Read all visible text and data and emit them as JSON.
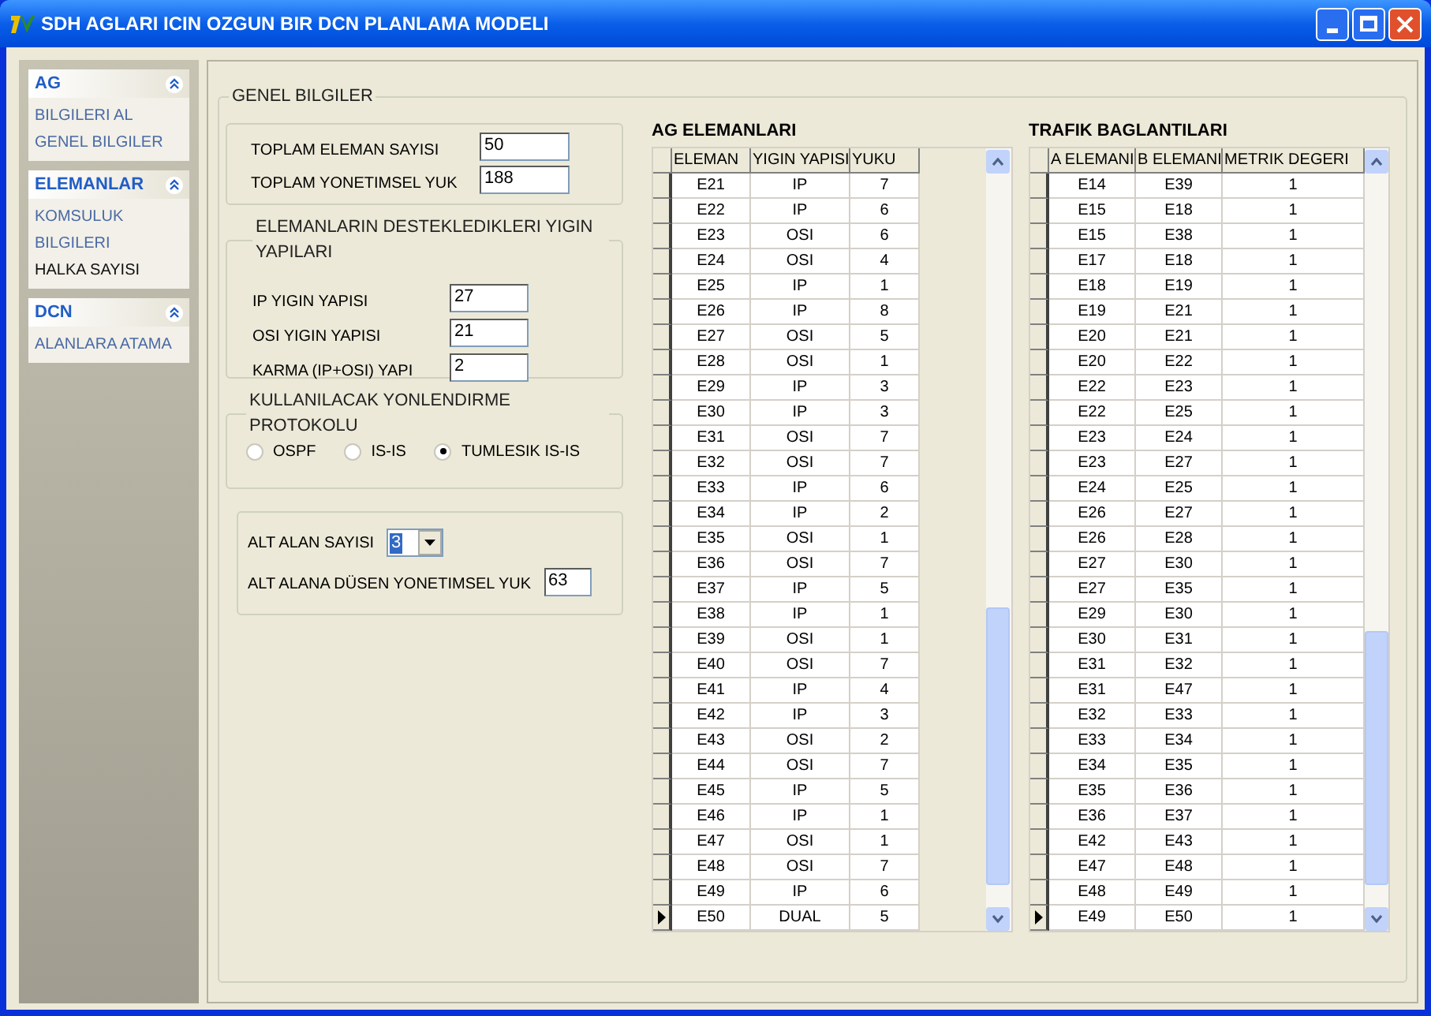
{
  "window": {
    "title": "SDH AGLARI ICIN OZGUN BIR DCN PLANLAMA MODELI"
  },
  "sidebar": [
    {
      "title": "AG",
      "items": [
        {
          "label": "BILGILERI AL",
          "selected": false
        },
        {
          "label": "GENEL BILGILER",
          "selected": false
        }
      ]
    },
    {
      "title": "ELEMANLAR",
      "items": [
        {
          "label": "KOMSULUK BILGILERI",
          "selected": false
        },
        {
          "label": "HALKA SAYISI",
          "selected": true
        }
      ]
    },
    {
      "title": "DCN",
      "items": [
        {
          "label": "ALANLARA ATAMA",
          "selected": false
        }
      ]
    }
  ],
  "main": {
    "title": "GENEL BILGILER",
    "totals": [
      {
        "label": "TOPLAM ELEMAN SAYISI",
        "value": "50"
      },
      {
        "label": "TOPLAM YONETIMSEL YUK",
        "value": "188"
      }
    ],
    "stacks": {
      "title": "ELEMANLARIN DESTEKLEDIKLERI YIGIN YAPILARI",
      "fields": [
        {
          "label": "IP YIGIN YAPISI",
          "value": "27"
        },
        {
          "label": "OSI YIGIN YAPISI",
          "value": "21"
        },
        {
          "label": "KARMA (IP+OSI) YAPI",
          "value": "2"
        }
      ]
    },
    "protocol": {
      "title": "KULLANILACAK YONLENDIRME PROTOKOLU",
      "options": [
        {
          "label": "OSPF",
          "selected": false
        },
        {
          "label": "IS-IS",
          "selected": false
        },
        {
          "label": "TUMLESIK IS-IS",
          "selected": true
        }
      ]
    },
    "subarea": {
      "count_label": "ALT ALAN SAYISI",
      "count_value": "3",
      "load_label": "ALT ALANA DÜSEN YONETIMSEL YUK",
      "load_value": "63"
    }
  },
  "tables": [
    {
      "title": "AG ELEMANLARI",
      "columns": [
        "ELEMAN",
        "YIGIN YAPISI",
        "YUKU"
      ],
      "rows": [
        {
          "cells": [
            "E21",
            "IP",
            "7"
          ],
          "selected": false
        },
        {
          "cells": [
            "E22",
            "IP",
            "6"
          ],
          "selected": false
        },
        {
          "cells": [
            "E23",
            "OSI",
            "6"
          ],
          "selected": false
        },
        {
          "cells": [
            "E24",
            "OSI",
            "4"
          ],
          "selected": false
        },
        {
          "cells": [
            "E25",
            "IP",
            "1"
          ],
          "selected": false
        },
        {
          "cells": [
            "E26",
            "IP",
            "8"
          ],
          "selected": false
        },
        {
          "cells": [
            "E27",
            "OSI",
            "5"
          ],
          "selected": false
        },
        {
          "cells": [
            "E28",
            "OSI",
            "1"
          ],
          "selected": false
        },
        {
          "cells": [
            "E29",
            "IP",
            "3"
          ],
          "selected": false
        },
        {
          "cells": [
            "E30",
            "IP",
            "3"
          ],
          "selected": false
        },
        {
          "cells": [
            "E31",
            "OSI",
            "7"
          ],
          "selected": false
        },
        {
          "cells": [
            "E32",
            "OSI",
            "7"
          ],
          "selected": false
        },
        {
          "cells": [
            "E33",
            "IP",
            "6"
          ],
          "selected": false
        },
        {
          "cells": [
            "E34",
            "IP",
            "2"
          ],
          "selected": false
        },
        {
          "cells": [
            "E35",
            "OSI",
            "1"
          ],
          "selected": false
        },
        {
          "cells": [
            "E36",
            "OSI",
            "7"
          ],
          "selected": false
        },
        {
          "cells": [
            "E37",
            "IP",
            "5"
          ],
          "selected": false
        },
        {
          "cells": [
            "E38",
            "IP",
            "1"
          ],
          "selected": false
        },
        {
          "cells": [
            "E39",
            "OSI",
            "1"
          ],
          "selected": false
        },
        {
          "cells": [
            "E40",
            "OSI",
            "7"
          ],
          "selected": false
        },
        {
          "cells": [
            "E41",
            "IP",
            "4"
          ],
          "selected": false
        },
        {
          "cells": [
            "E42",
            "IP",
            "3"
          ],
          "selected": false
        },
        {
          "cells": [
            "E43",
            "OSI",
            "2"
          ],
          "selected": false
        },
        {
          "cells": [
            "E44",
            "OSI",
            "7"
          ],
          "selected": false
        },
        {
          "cells": [
            "E45",
            "IP",
            "5"
          ],
          "selected": false
        },
        {
          "cells": [
            "E46",
            "IP",
            "1"
          ],
          "selected": false
        },
        {
          "cells": [
            "E47",
            "OSI",
            "1"
          ],
          "selected": false
        },
        {
          "cells": [
            "E48",
            "OSI",
            "7"
          ],
          "selected": false
        },
        {
          "cells": [
            "E49",
            "IP",
            "6"
          ],
          "selected": false
        },
        {
          "cells": [
            "E50",
            "DUAL",
            "5"
          ],
          "selected": true
        }
      ]
    },
    {
      "title": "TRAFIK BAGLANTILARI",
      "columns": [
        "A ELEMANI",
        "B ELEMANI",
        "METRIK DEGERI"
      ],
      "rows": [
        {
          "cells": [
            "E14",
            "E39",
            "1"
          ],
          "selected": false
        },
        {
          "cells": [
            "E15",
            "E18",
            "1"
          ],
          "selected": false
        },
        {
          "cells": [
            "E15",
            "E38",
            "1"
          ],
          "selected": false
        },
        {
          "cells": [
            "E17",
            "E18",
            "1"
          ],
          "selected": false
        },
        {
          "cells": [
            "E18",
            "E19",
            "1"
          ],
          "selected": false
        },
        {
          "cells": [
            "E19",
            "E21",
            "1"
          ],
          "selected": false
        },
        {
          "cells": [
            "E20",
            "E21",
            "1"
          ],
          "selected": false
        },
        {
          "cells": [
            "E20",
            "E22",
            "1"
          ],
          "selected": false
        },
        {
          "cells": [
            "E22",
            "E23",
            "1"
          ],
          "selected": false
        },
        {
          "cells": [
            "E22",
            "E25",
            "1"
          ],
          "selected": false
        },
        {
          "cells": [
            "E23",
            "E24",
            "1"
          ],
          "selected": false
        },
        {
          "cells": [
            "E23",
            "E27",
            "1"
          ],
          "selected": false
        },
        {
          "cells": [
            "E24",
            "E25",
            "1"
          ],
          "selected": false
        },
        {
          "cells": [
            "E26",
            "E27",
            "1"
          ],
          "selected": false
        },
        {
          "cells": [
            "E26",
            "E28",
            "1"
          ],
          "selected": false
        },
        {
          "cells": [
            "E27",
            "E30",
            "1"
          ],
          "selected": false
        },
        {
          "cells": [
            "E27",
            "E35",
            "1"
          ],
          "selected": false
        },
        {
          "cells": [
            "E29",
            "E30",
            "1"
          ],
          "selected": false
        },
        {
          "cells": [
            "E30",
            "E31",
            "1"
          ],
          "selected": false
        },
        {
          "cells": [
            "E31",
            "E32",
            "1"
          ],
          "selected": false
        },
        {
          "cells": [
            "E31",
            "E47",
            "1"
          ],
          "selected": false
        },
        {
          "cells": [
            "E32",
            "E33",
            "1"
          ],
          "selected": false
        },
        {
          "cells": [
            "E33",
            "E34",
            "1"
          ],
          "selected": false
        },
        {
          "cells": [
            "E34",
            "E35",
            "1"
          ],
          "selected": false
        },
        {
          "cells": [
            "E35",
            "E36",
            "1"
          ],
          "selected": false
        },
        {
          "cells": [
            "E36",
            "E37",
            "1"
          ],
          "selected": false
        },
        {
          "cells": [
            "E42",
            "E43",
            "1"
          ],
          "selected": false
        },
        {
          "cells": [
            "E47",
            "E48",
            "1"
          ],
          "selected": false
        },
        {
          "cells": [
            "E48",
            "E49",
            "1"
          ],
          "selected": false
        },
        {
          "cells": [
            "E49",
            "E50",
            "1"
          ],
          "selected": true
        }
      ]
    }
  ]
}
